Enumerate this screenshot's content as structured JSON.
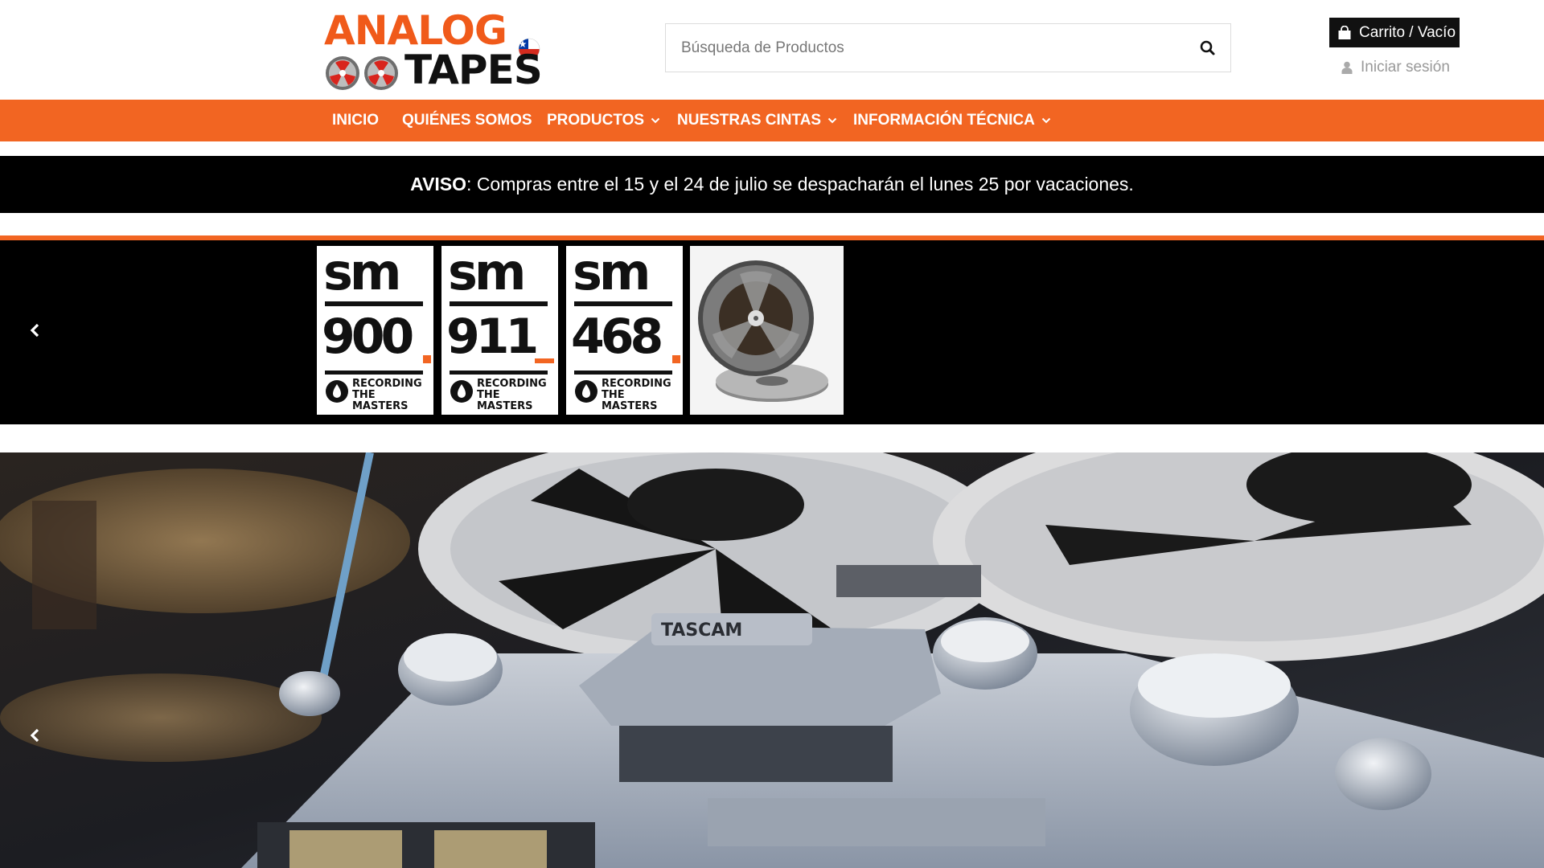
{
  "brand": {
    "logo_line1": "ANALOG",
    "logo_line2": "TAPES",
    "colors": {
      "accent": "#f26522",
      "dark": "#111111",
      "flag_red": "#d52b1e",
      "flag_blue": "#0039a6"
    }
  },
  "search": {
    "placeholder": "Búsqueda de Productos",
    "icon": "search-icon"
  },
  "account": {
    "cart_label": "Carrito / Vacío",
    "cart_icon": "shopping-bag-icon",
    "login_label": "Iniciar sesión",
    "login_icon": "user-icon"
  },
  "nav": {
    "items": [
      {
        "label": "INICIO",
        "dropdown": false
      },
      {
        "label": "QUIÉNES SOMOS",
        "dropdown": false
      },
      {
        "label": "PRODUCTOS",
        "dropdown": true
      },
      {
        "label": "NUESTRAS CINTAS",
        "dropdown": true
      },
      {
        "label": "INFORMACIÓN TÉCNICA",
        "dropdown": true
      }
    ]
  },
  "notice": {
    "label": "AVISO",
    "text": ": Compras entre el 15 y el 24 de julio se despacharán el lunes 25 por vacaciones."
  },
  "products": [
    {
      "brand": "sm",
      "model": "900",
      "badge_line1": "RECORDING",
      "badge_line2": "THE MASTERS"
    },
    {
      "brand": "sm",
      "model": "911",
      "badge_line1": "RECORDING",
      "badge_line2": "THE MASTERS"
    },
    {
      "brand": "sm",
      "model": "468",
      "badge_line1": "RECORDING",
      "badge_line2": "THE MASTERS"
    },
    {
      "image": "tape-reel"
    }
  ],
  "hero": {
    "image": "tascam-reel-to-reel-recorder",
    "brand_on_device": "TASCAM"
  },
  "controls": {
    "prev_icon": "chevron-left-icon"
  }
}
